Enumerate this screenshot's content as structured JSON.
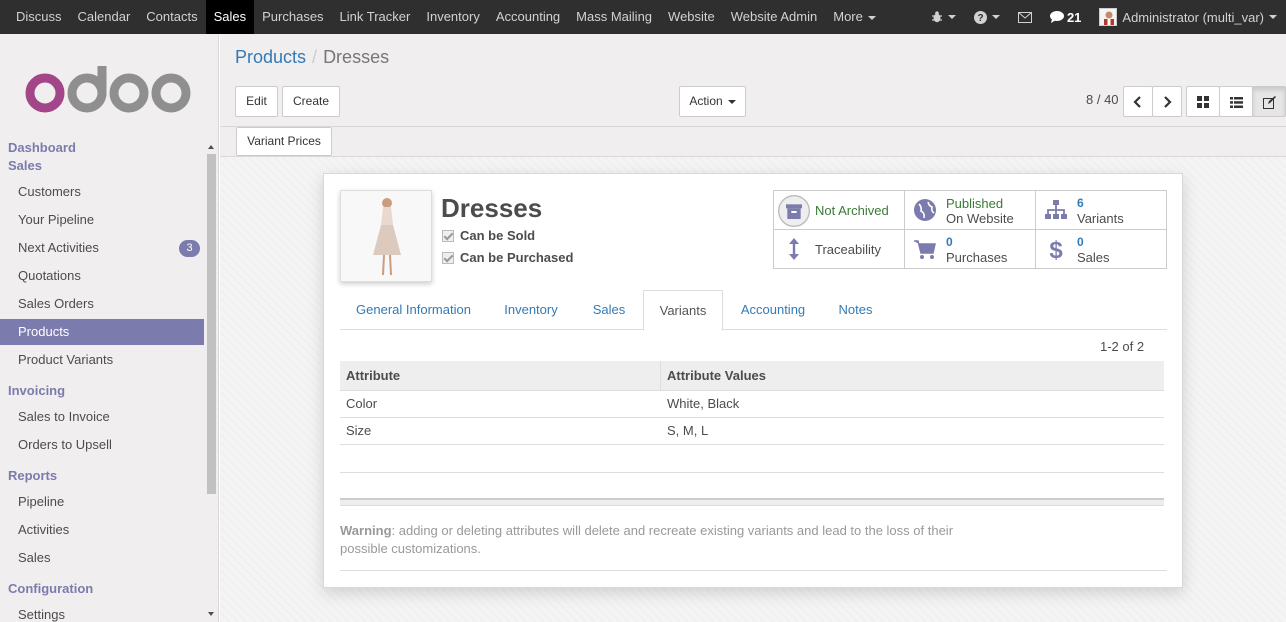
{
  "topbar": {
    "menu": [
      "Discuss",
      "Calendar",
      "Contacts",
      "Sales",
      "Purchases",
      "Link Tracker",
      "Inventory",
      "Accounting",
      "Mass Mailing",
      "Website",
      "Website Admin",
      "More"
    ],
    "active": "Sales",
    "messages_count": "21",
    "user": "Administrator (multi_var)"
  },
  "sidebar": {
    "sections": [
      {
        "title": "Dashboard"
      },
      {
        "title": "Sales",
        "items": [
          "Customers",
          "Your Pipeline",
          "Next Activities",
          "Quotations",
          "Sales Orders",
          "Products",
          "Product Variants"
        ]
      },
      {
        "title": "Invoicing",
        "items": [
          "Sales to Invoice",
          "Orders to Upsell"
        ]
      },
      {
        "title": "Reports",
        "items": [
          "Pipeline",
          "Activities",
          "Sales"
        ]
      },
      {
        "title": "Configuration",
        "items": [
          "Settings"
        ]
      }
    ],
    "next_activities_badge": "3",
    "active_item": "Products"
  },
  "breadcrumb": {
    "parent": "Products",
    "separator": "/",
    "current": "Dresses"
  },
  "buttons": {
    "edit": "Edit",
    "create": "Create",
    "action": "Action",
    "variant_prices": "Variant Prices"
  },
  "pager": "8 / 40",
  "product": {
    "name": "Dresses",
    "can_be_sold": "Can be Sold",
    "can_be_purchased": "Can be Purchased"
  },
  "stats": {
    "archive": "Not Archived",
    "published_l1": "Published",
    "published_l2": "On Website",
    "variants_count": "6",
    "variants_label": "Variants",
    "traceability": "Traceability",
    "purchases_count": "0",
    "purchases_label": "Purchases",
    "sales_count": "0",
    "sales_label": "Sales"
  },
  "tabs": [
    "General Information",
    "Inventory",
    "Sales",
    "Variants",
    "Accounting",
    "Notes"
  ],
  "active_tab": "Variants",
  "list_pager": "1-2 of 2",
  "table": {
    "headers": [
      "Attribute",
      "Attribute Values"
    ],
    "rows": [
      [
        "Color",
        "White, Black"
      ],
      [
        "Size",
        "S, M, L"
      ]
    ]
  },
  "warning": {
    "label": "Warning",
    "text": ": adding or deleting attributes will delete and recreate existing variants and lead to the loss of their possible customizations."
  },
  "colors": {
    "brand": "#7c7bad",
    "link": "#337ab7",
    "topbar": "#2f2f2f"
  }
}
